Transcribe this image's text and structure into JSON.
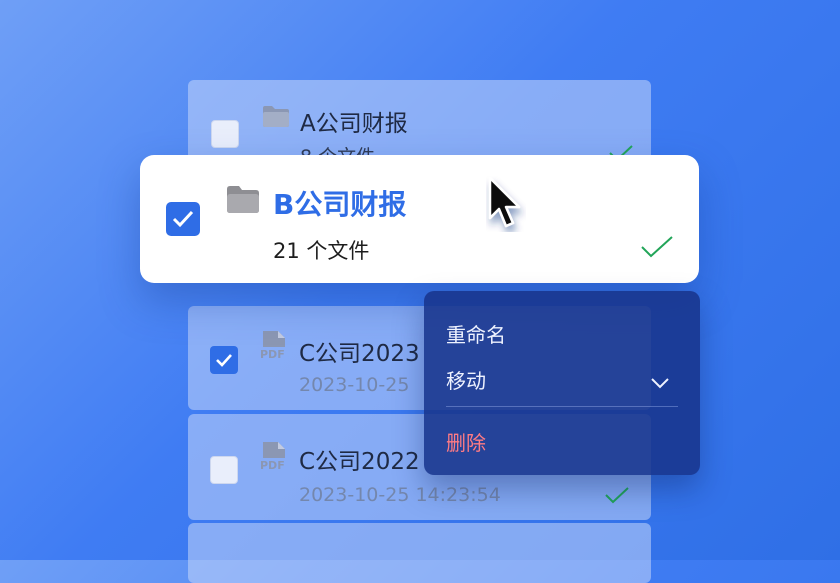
{
  "files": [
    {
      "name": "A公司财报",
      "meta": "8  个文件",
      "type": "folder",
      "checked": false
    },
    {
      "name": "B公司财报",
      "meta": "21  个文件",
      "type": "folder",
      "checked": true
    },
    {
      "name": "C公司2023",
      "meta": "2023-10-25",
      "type": "pdf",
      "checked": true
    },
    {
      "name": "C公司2022",
      "meta": "2023-10-25 14:23:54",
      "type": "pdf",
      "checked": false
    }
  ],
  "pdf_label": "PDF",
  "context_menu": {
    "rename": "重命名",
    "move": "移动",
    "delete": "删除"
  },
  "colors": {
    "accent": "#2f6de6",
    "success": "#22a559",
    "danger": "#ff7b84"
  }
}
